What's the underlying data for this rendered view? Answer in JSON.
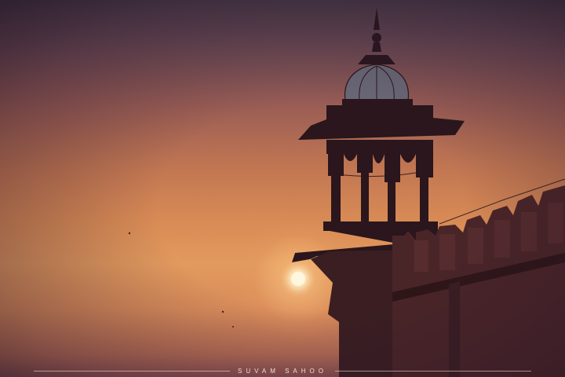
{
  "photo": {
    "subject": "sunset-minaret",
    "colors": {
      "sky_top": "#4a3c4a",
      "sky_mid": "#c27752",
      "sky_glow": "#e29a5e",
      "silhouette": "#2a161c",
      "wall": "#4a2528",
      "sun": "#fff6e0"
    }
  },
  "watermark": {
    "text": "SUVAM SAHOO"
  }
}
